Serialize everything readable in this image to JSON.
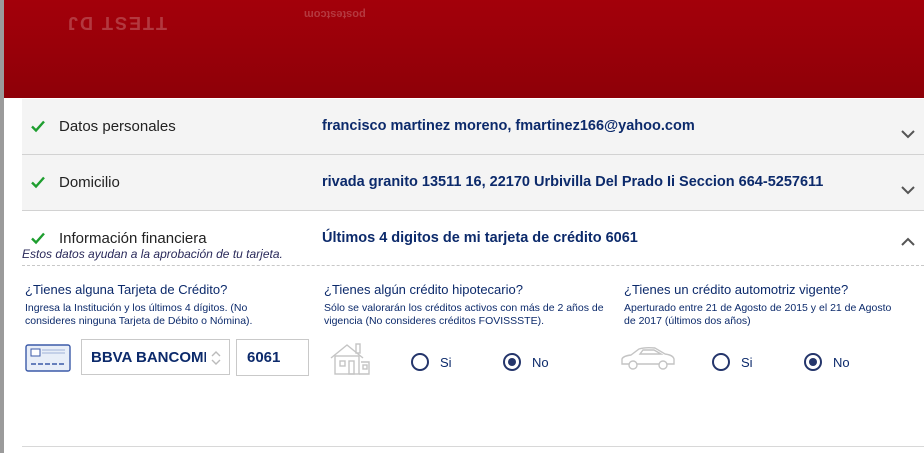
{
  "banner": {
    "ghost_text_1": "TTEST DJ",
    "ghost_text_2": "postestcom"
  },
  "sections": [
    {
      "title": "Datos personales",
      "value": "francisco martinez moreno, fmartinez166@yahoo.com",
      "status_icon": "check-icon",
      "toggle_icon": "chevron-down-icon"
    },
    {
      "title": "Domicilio",
      "value": "rivada granito 13511 16, 22170 Urbivilla Del Prado Ii Seccion 664-5257611",
      "status_icon": "check-icon",
      "toggle_icon": "chevron-down-icon"
    },
    {
      "title": "Información financiera",
      "value": "Últimos 4 digitos de mi tarjeta de crédito 6061",
      "status_icon": "check-icon",
      "toggle_icon": "chevron-up-icon"
    }
  ],
  "finance": {
    "hint": "Estos datos ayudan a la aprobación de tu tarjeta.",
    "credit_card": {
      "question": "¿Tienes alguna Tarjeta de Crédito?",
      "help": "Ingresa la Institución y los últimos 4 dígitos. (No consideres ninguna Tarjeta de Débito o Nómina).",
      "bank_selected": "BBVA BANCOMER",
      "last_digits": "6061",
      "icon": "credit-card-icon"
    },
    "mortgage": {
      "question": "¿Tienes algún crédito hipotecario?",
      "help": "Sólo se valorarán los créditos activos con más de 2 años de vigencia (No consideres créditos FOVISSSTE).",
      "icon": "house-icon",
      "options": [
        "Si",
        "No"
      ],
      "selected": "No"
    },
    "auto": {
      "question": "¿Tienes un crédito automotriz vigente?",
      "help": "Aperturado entre 21 de Agosto de 2015 y el 21 de Agosto de 2017 (últimos dos años)",
      "icon": "car-icon",
      "options": [
        "Si",
        "No"
      ],
      "selected": "No"
    }
  },
  "colors": {
    "brand_red": "#9b0009",
    "text_navy": "#0c2a6b",
    "check_green": "#1e9e2f"
  }
}
